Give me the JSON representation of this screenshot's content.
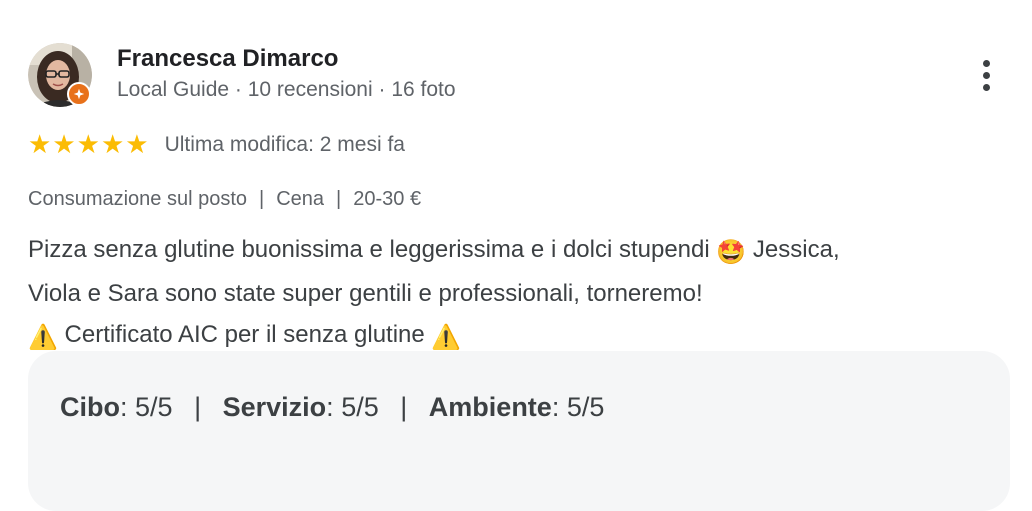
{
  "reviewer": {
    "name": "Francesca Dimarco",
    "meta": "Local Guide · 10 recensioni · 16 foto",
    "avatar_icon": "user-photo",
    "badge_icon": "local-guide-star-icon",
    "badge_color": "#e8711a"
  },
  "more_menu": {
    "icon": "more-vertical-icon"
  },
  "rating": {
    "stars": 5,
    "max": 5,
    "star_glyph": "★",
    "star_color": "#fbbc04",
    "edited": "Ultima modifica: 2 mesi fa"
  },
  "attributes": {
    "items": [
      "Consumazione sul posto",
      "Cena",
      "20-30 €"
    ],
    "separator": "|"
  },
  "review": {
    "line1_text": "Pizza senza glutine buonissima e leggerissima e i dolci stupendi ",
    "line1_emoji": "🤩",
    "line1_tail": " Jessica,",
    "line2": "Viola e Sara sono state super gentili e professionali, torneremo!",
    "line3_emoji_start": "⚠️",
    "line3_text": " Certificato AIC per il senza glutine ",
    "line3_emoji_end": "⚠️"
  },
  "sub_ratings": {
    "items": [
      {
        "label": "Cibo",
        "value": "5/5"
      },
      {
        "label": "Servizio",
        "value": "5/5"
      },
      {
        "label": "Ambiente",
        "value": "5/5"
      }
    ],
    "separator": "|",
    "label_value_separator": ":"
  }
}
